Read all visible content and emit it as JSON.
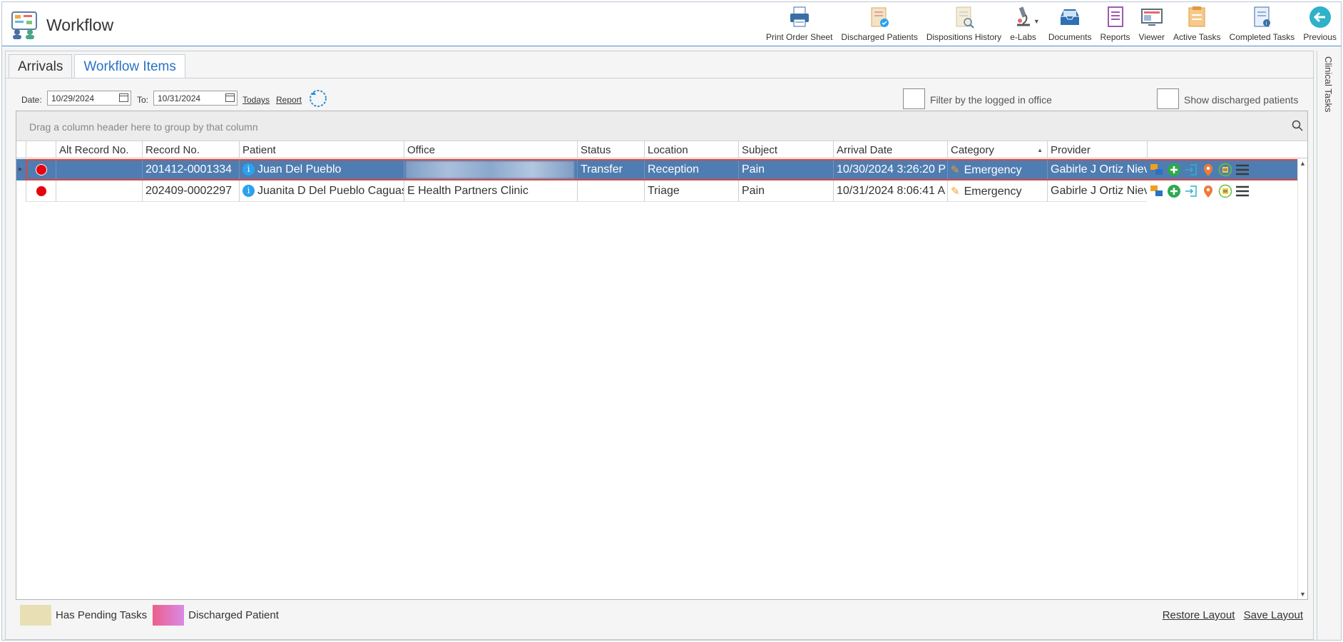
{
  "app": {
    "title": "Workflow"
  },
  "toolbar": [
    {
      "label": "Print Order Sheet",
      "icon": "printer-icon"
    },
    {
      "label": "Discharged Patients",
      "icon": "discharged-patients-icon"
    },
    {
      "label": "Dispositions History",
      "icon": "dispositions-history-icon"
    },
    {
      "label": "e-Labs",
      "icon": "microscope-icon"
    },
    {
      "label": "Documents",
      "icon": "documents-inbox-icon"
    },
    {
      "label": "Reports",
      "icon": "reports-icon"
    },
    {
      "label": "Viewer",
      "icon": "viewer-icon"
    },
    {
      "label": "Active Tasks",
      "icon": "active-tasks-icon"
    },
    {
      "label": "Completed Tasks",
      "icon": "completed-tasks-icon"
    },
    {
      "label": "Previous",
      "icon": "previous-arrow-icon"
    }
  ],
  "side_panel": {
    "label": "Clinical Tasks"
  },
  "tabs": [
    {
      "label": "Arrivals",
      "active": true
    },
    {
      "label": "Workflow Items",
      "active": false
    }
  ],
  "filters": {
    "date_label": "Date:",
    "date_from": "10/29/2024",
    "to_label": "To:",
    "date_to": "10/31/2024",
    "todays_link": "Todays",
    "report_link": "Report",
    "filter_office_label": "Filter by the logged in office",
    "show_discharged_label": "Show discharged patients"
  },
  "grid": {
    "group_prompt": "Drag a column header here to group by that column",
    "columns": [
      "",
      "Alt Record No.",
      "Record No.",
      "Patient",
      "Office",
      "Status",
      "Location",
      "Subject",
      "Arrival Date",
      "Category",
      "Provider"
    ],
    "rows": [
      {
        "alt_record": "",
        "record": "201412-0001334",
        "patient": "Juan Del Pueblo",
        "office": "",
        "status": "Transfer",
        "location": "Reception",
        "subject": "Pain",
        "arrival": "10/30/2024 3:26:20 P",
        "category": "Emergency",
        "provider": "Gabirle J Ortiz Nieve"
      },
      {
        "alt_record": "",
        "record": "202409-0002297",
        "patient": "Juanita D Del Pueblo Caguas",
        "office": "E Health Partners Clinic",
        "status": "",
        "location": "Triage",
        "subject": "Pain",
        "arrival": "10/31/2024 8:06:41 A",
        "category": "Emergency",
        "provider": "Gabirle J Ortiz Nieve"
      }
    ]
  },
  "legend": {
    "pending_label": "Has Pending Tasks",
    "pending_color": "#e8e0b4",
    "discharged_label": "Discharged Patient",
    "discharged_color": "#e57ad0"
  },
  "footer": {
    "restore": "Restore Layout",
    "save": "Save Layout"
  },
  "colors": {
    "selected_row": "#4f7db1",
    "accent": "#2a72c3",
    "status_dot": "#e8000f"
  }
}
